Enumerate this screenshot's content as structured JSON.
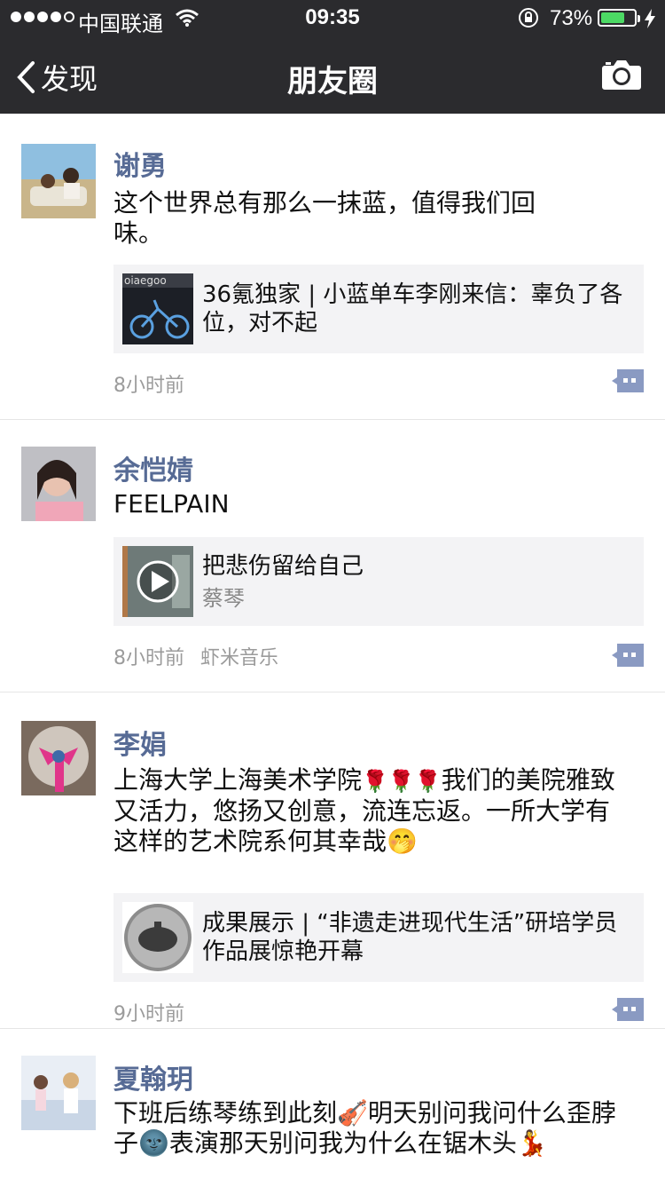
{
  "status_bar": {
    "carrier": "中国联通",
    "time": "09:35",
    "battery": "73%",
    "battery_level": 0.73
  },
  "nav": {
    "back_label": "发现",
    "title": "朋友圈"
  },
  "posts": [
    {
      "name": "谢勇",
      "text": "这个世界总有那么一抹蓝，值得我们回味。",
      "card_title": "36氪独家 | 小蓝单车李刚来信：辜负了各位，对不起",
      "time": "8小时前"
    },
    {
      "name": "余恺婧",
      "text": "FEELPAIN",
      "card_title": "把悲伤留给自己",
      "card_subtitle": "蔡琴",
      "time": "8小时前",
      "source": "虾米音乐"
    },
    {
      "name": "李娟",
      "text_before_flowers": "上海大学上海美术学院",
      "text_after_flowers": "我们的美院雅致又活力，悠扬又创意，流连忘返。一所大学有这样的艺术院系何其幸哉",
      "card_title": "成果展示 | “非遗走进现代生活”研培学员作品展惊艳开幕",
      "time": "9小时前"
    },
    {
      "name": "夏翰玥",
      "text_1": "下班后练琴练到此刻",
      "text_2": "明天别问我问什么歪脖子",
      "text_3": "表演那天别问我为什么在锯木头"
    }
  ],
  "emoji": {
    "rose": "🌹",
    "violin": "🎻",
    "moon": "🌚",
    "shy": "🤭",
    "dancer": "💃"
  }
}
